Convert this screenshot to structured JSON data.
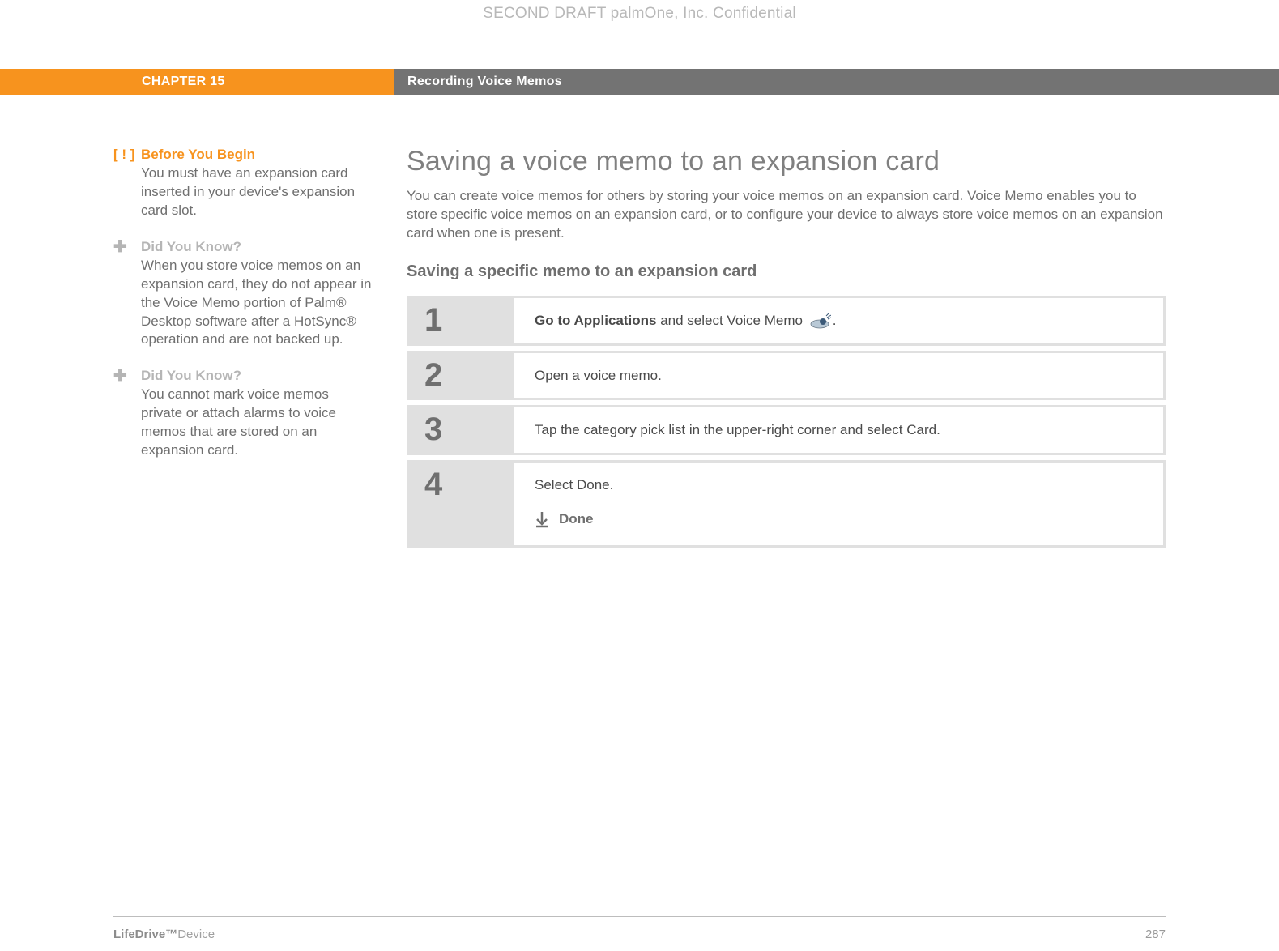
{
  "draft_header": "SECOND DRAFT palmOne, Inc.  Confidential",
  "chapter": {
    "label": "CHAPTER 15",
    "title": "Recording Voice Memos"
  },
  "sidebar": {
    "before": {
      "marker": "[ ! ]",
      "title": "Before You Begin",
      "text": "You must have an expansion card inserted in your device's expansion card slot."
    },
    "dyk1": {
      "marker": "✚",
      "title": "Did You Know?",
      "text": "When you store voice memos on an expansion card, they do not appear in the Voice Memo portion of Palm® Desktop software after a HotSync® operation and are not backed up."
    },
    "dyk2": {
      "marker": "✚",
      "title": "Did You Know?",
      "text": "You cannot mark voice memos private or attach alarms to voice memos that are stored on an expansion card."
    }
  },
  "main": {
    "h1": "Saving a voice memo to an expansion card",
    "intro": "You can create voice memos for others by storing your voice memos on an expansion card. Voice Memo enables you to store specific voice memos on an expansion card, or to configure your device to always store voice memos on an expansion card when one is present.",
    "h2": "Saving a specific memo to an expansion card",
    "steps": [
      {
        "n": "1",
        "link": "Go to Applications",
        "after": " and select Voice Memo ",
        "tail": "."
      },
      {
        "n": "2",
        "text": "Open a voice memo."
      },
      {
        "n": "3",
        "text": "Tap the category pick list in the upper-right corner and select Card."
      },
      {
        "n": "4",
        "text": "Select Done.",
        "done": "Done"
      }
    ]
  },
  "footer": {
    "product_bold": "LifeDrive™",
    "product_light": "Device",
    "page": "287"
  }
}
